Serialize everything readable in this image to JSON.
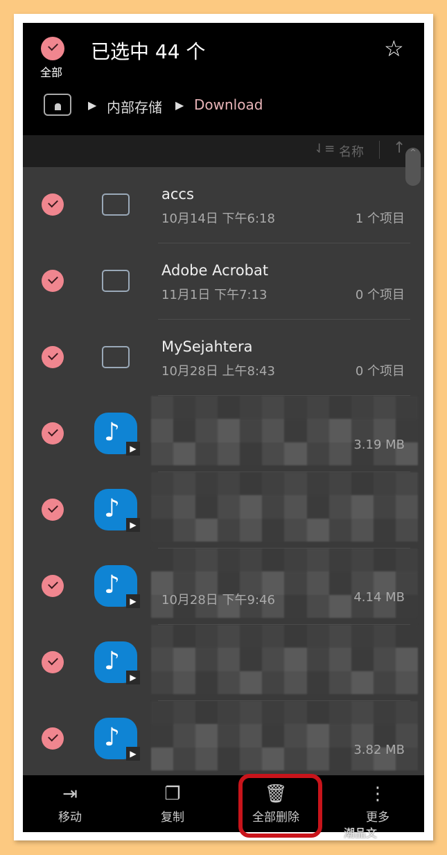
{
  "header": {
    "select_all_label": "全部",
    "title": "已选中 44 个",
    "favorite_icon": "star-icon"
  },
  "breadcrumb": {
    "root": "内部存储",
    "current": "Download",
    "current_color": "#e8b4b8"
  },
  "sort": {
    "label": "名称"
  },
  "files": [
    {
      "type": "folder",
      "name": "accs",
      "date": "10月14日 下午6:18",
      "meta": "1 个项目"
    },
    {
      "type": "folder",
      "name": "Adobe Acrobat",
      "date": "11月1日 下午7:13",
      "meta": "0 个项目"
    },
    {
      "type": "folder",
      "name": "MySejahtera",
      "date": "10月28日 上午8:43",
      "meta": "0 个项目"
    },
    {
      "type": "audio",
      "name": "",
      "date": "",
      "meta": "3.19 MB"
    },
    {
      "type": "audio",
      "name": "",
      "date": "",
      "meta": ""
    },
    {
      "type": "audio",
      "name": "",
      "date": "10月28日 下午9:46",
      "meta": "4.14 MB"
    },
    {
      "type": "audio",
      "name": "",
      "date": "",
      "meta": ""
    },
    {
      "type": "audio",
      "name": "",
      "date": "",
      "meta": "3.82 MB"
    }
  ],
  "bottom_bar": [
    {
      "label": "移动",
      "icon": "move-icon"
    },
    {
      "label": "复制",
      "icon": "copy-icon"
    },
    {
      "label": "全部删除",
      "icon": "trash-icon"
    },
    {
      "label": "更多",
      "icon": "more-icon"
    }
  ],
  "watermark": "潮品文",
  "colors": {
    "accent": "#f0868f",
    "highlight": "#c8141b",
    "audio_icon": "#0f84d4"
  }
}
